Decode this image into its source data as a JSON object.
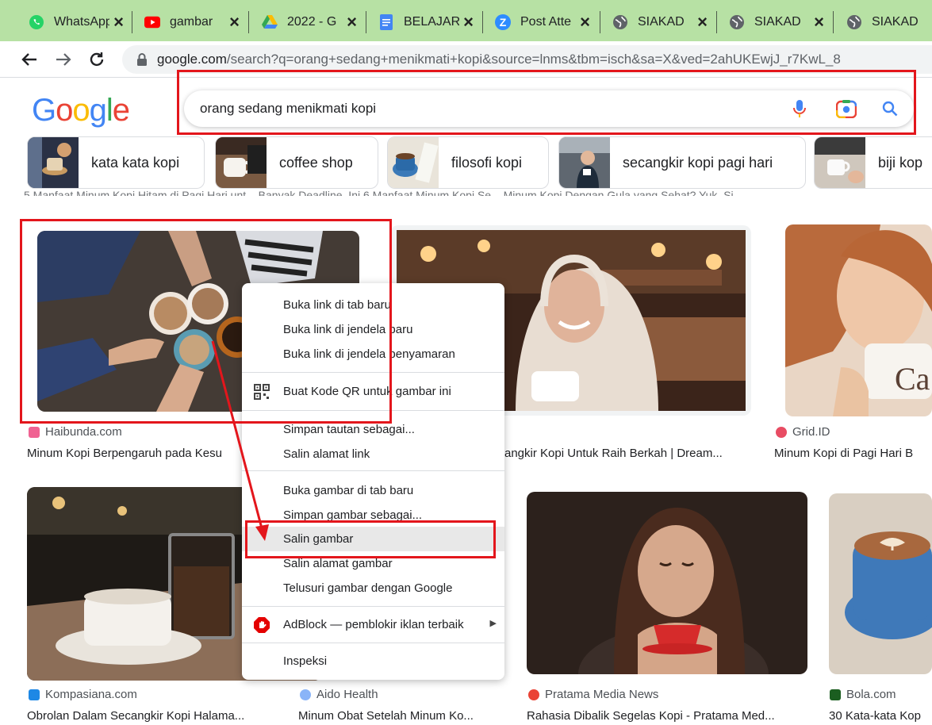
{
  "tabs": [
    {
      "label": "WhatsApp",
      "icon": "whatsapp-icon"
    },
    {
      "label": "gambar",
      "icon": "youtube-icon"
    },
    {
      "label": "2022 - G",
      "icon": "google-drive-icon"
    },
    {
      "label": "BELAJAR",
      "icon": "google-docs-icon"
    },
    {
      "label": "Post Atte",
      "icon": "zoom-icon"
    },
    {
      "label": "SIAKAD",
      "icon": "globe-icon"
    },
    {
      "label": "SIAKAD",
      "icon": "globe-icon"
    },
    {
      "label": "SIAKAD",
      "icon": "globe-icon"
    }
  ],
  "address_bar": {
    "host": "google.com",
    "path": "/search?q=orang+sedang+menikmati+kopi&source=lnms&tbm=isch&sa=X&ved=2ahUKEwjJ_r7KwL_8"
  },
  "search": {
    "logo": [
      "G",
      "o",
      "o",
      "g",
      "l",
      "e"
    ],
    "query": "orang sedang menikmati kopi"
  },
  "chips": [
    {
      "label": "kata kata kopi"
    },
    {
      "label": "coffee shop"
    },
    {
      "label": "filosofi kopi"
    },
    {
      "label": "secangkir kopi pagi hari"
    },
    {
      "label": "biji kop"
    }
  ],
  "cut_text": "5 Manfaat Minum Kopi Hitam di Pagi Hari unt...          Banyak Deadline, Ini 6 Manfaat Minum Kopi Se...          Minum Kopi Dengan Gula yang Sehat? Yuk, Si",
  "results": [
    {
      "source": "Haibunda.com",
      "title": "Minum Kopi Berpengaruh pada Kesu"
    },
    {
      "source": "",
      "title": "angkir Kopi Untuk Raih Berkah | Dream..."
    },
    {
      "source": "Grid.ID",
      "title": "Minum Kopi di Pagi Hari B"
    },
    {
      "source": "Kompasiana.com",
      "title": "Obrolan Dalam Secangkir Kopi Halama..."
    },
    {
      "source": "Aido Health",
      "title": "Minum Obat Setelah Minum Ko..."
    },
    {
      "source": "Pratama Media News",
      "title": "Rahasia Dibalik Segelas Kopi - Pratama Med..."
    },
    {
      "source": "Bola.com",
      "title": "30 Kata-kata Kop"
    }
  ],
  "context_menu": {
    "open_link_new_tab": "Buka link di tab baru",
    "open_link_new_window": "Buka link di jendela baru",
    "open_link_incognito": "Buka link di jendela penyamaran",
    "create_qr": "Buat Kode QR untuk gambar ini",
    "save_link_as": "Simpan tautan sebagai...",
    "copy_link_address": "Salin alamat link",
    "open_image_new_tab": "Buka gambar di tab baru",
    "save_image_as": "Simpan gambar sebagai...",
    "copy_image": "Salin gambar",
    "copy_image_address": "Salin alamat gambar",
    "search_image_google": "Telusuri gambar dengan Google",
    "adblock": "AdBlock — pemblokir iklan terbaik",
    "inspect": "Inspeksi"
  },
  "colors": {
    "tabstrip": "#b7e1a4",
    "annotation_red": "#e3161c",
    "google_blue": "#4285f4",
    "google_red": "#ea4335",
    "google_yellow": "#fbbc05",
    "google_green": "#34a853"
  }
}
